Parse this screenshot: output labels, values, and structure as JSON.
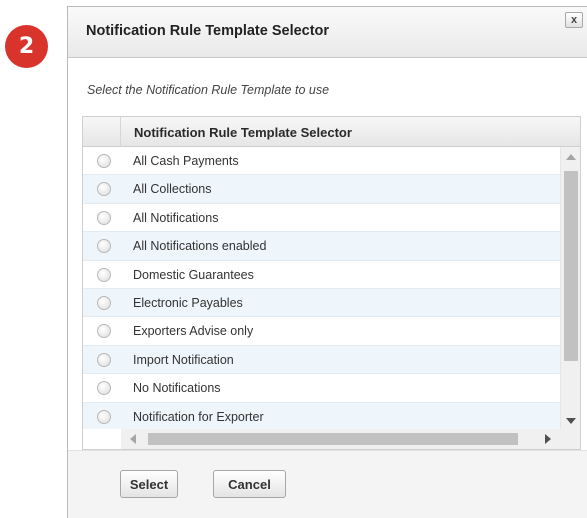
{
  "step_badge": "2",
  "dialog": {
    "title": "Notification Rule Template Selector",
    "close_label": "x",
    "instruction": "Select the Notification Rule Template to use"
  },
  "grid": {
    "column_header": "Notification Rule Template Selector",
    "rows": [
      {
        "label": "All Cash Payments"
      },
      {
        "label": "All Collections"
      },
      {
        "label": "All Notifications"
      },
      {
        "label": "All Notifications enabled"
      },
      {
        "label": "Domestic Guarantees"
      },
      {
        "label": "Electronic Payables"
      },
      {
        "label": "Exporters Advise only"
      },
      {
        "label": "Import Notification"
      },
      {
        "label": "No Notifications"
      },
      {
        "label": "Notification for Exporter"
      }
    ]
  },
  "footer": {
    "select_label": "Select",
    "cancel_label": "Cancel"
  },
  "colors": {
    "badge": "#d9342b",
    "row_alt": "#eef5fb"
  }
}
